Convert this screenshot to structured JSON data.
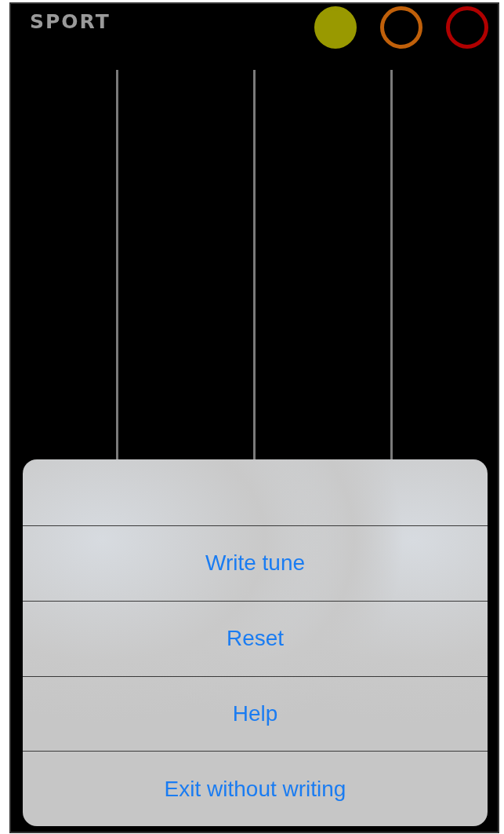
{
  "header": {
    "mode": "SPORT"
  },
  "lights": [
    {
      "color": "#999900",
      "on": true
    },
    {
      "color": "#c0600a",
      "on": false
    },
    {
      "color": "#b00000",
      "on": false
    }
  ],
  "action_sheet": {
    "actions": [
      "Write tune",
      "Reset",
      "Help",
      "Exit without writing"
    ]
  }
}
